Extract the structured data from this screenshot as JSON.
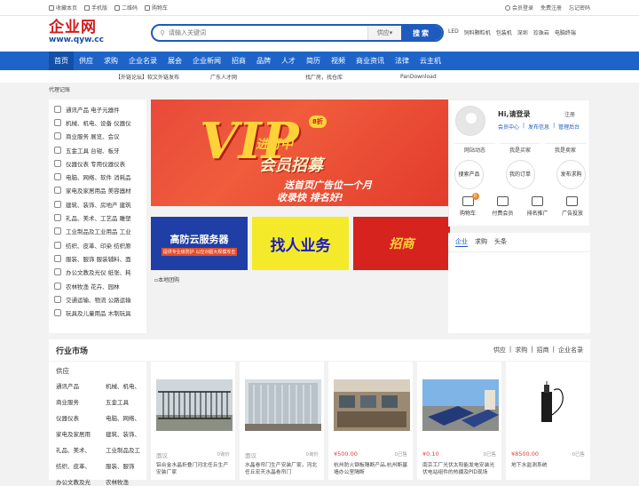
{
  "topbar": {
    "left": [
      "收藏本页",
      "手机版",
      "二维码",
      "购物车"
    ],
    "right": [
      "会员登录",
      "免费注册",
      "忘记密码"
    ]
  },
  "logo": {
    "cn": "企业网",
    "en": "www.qyw.cc"
  },
  "search": {
    "placeholder": "请输入关键词",
    "select": "供应",
    "button": "搜索"
  },
  "hot_keywords": [
    "LED",
    "饲料颗粒机",
    "包装机",
    "深圳",
    "珍珠岩",
    "电脑终端"
  ],
  "nav": [
    "首页",
    "供应",
    "求购",
    "企业名录",
    "展会",
    "企业新闻",
    "招商",
    "品牌",
    "人才",
    "简历",
    "视频",
    "商业资讯",
    "法律",
    "云主机"
  ],
  "subnav": [
    "【外链论坛】软文外链发布",
    "广东人才网",
    "找厂房，找仓库",
    "PanDownload"
  ],
  "agent_text": "代理记账",
  "categories": [
    "通讯产品 电子元器件",
    "机械、机电、设备 仪器仪",
    "商业服务 展览、会议",
    "五金工具 台钳、板牙",
    "仪器仪表 专用仪器仪表",
    "电脑、网络、软件 消耗品",
    "家电及家居用品 美容器材",
    "建筑、装饰、房地产 建筑",
    "礼品、美术、工艺品 雕塑",
    "工业制品及工业用品 工业",
    "纺织、皮革、印染 纺织原",
    "服装、服饰 服装辅料、面",
    "办公文教及光仪 纸张、耗",
    "农林牧渔 花卉、园林",
    "交通运输、物流 公路运输",
    "玩具及儿童用品 木制玩具"
  ],
  "banner": {
    "vip": "VIP",
    "tag": "8折",
    "t1": "进行中",
    "t2": "会员招募",
    "t3": "送首页广告位一个月",
    "t4": "收录快 排名好!"
  },
  "ads": {
    "ad1_title": "高防云服务器",
    "ad1_sub": "提供专业级防护 以应对超大规模攻击",
    "ad2_title": "找人业务",
    "ad3_title": "招商"
  },
  "ad_text": "本地团购",
  "user": {
    "greeting": "Hi,请登录",
    "register": "注册",
    "links": [
      "会员中心",
      "发布信息",
      "管理后台"
    ],
    "tabs": [
      "网站动态",
      "我是买家",
      "我是卖家"
    ],
    "circles": [
      "搜索产品",
      "我的订单",
      "发布求购"
    ],
    "quick": [
      "购物车",
      "付费会员",
      "排名推广",
      "广告投放"
    ],
    "cart_count": "0"
  },
  "news_tabs": [
    "企业",
    "求购",
    "头条"
  ],
  "market": {
    "title": "行业市场",
    "links": [
      "供应",
      "求购",
      "招商",
      "企业名录"
    ]
  },
  "side": {
    "heading": "供应",
    "items": [
      "通讯产品",
      "机械、机电、",
      "商业服务",
      "五金工具",
      "仪器仪表",
      "电脑、网络、",
      "家电及家居用",
      "建筑、装饰、",
      "礼品、美术、",
      "工业制品及工",
      "纺织、皮革、",
      "服装、服饰",
      "办公文教及光",
      "农林牧渔"
    ]
  },
  "products": [
    {
      "price": "面议",
      "count": "0询价",
      "title": "铝合金水晶折叠门河北任丘生产安装厂家",
      "price_red": false
    },
    {
      "price": "面议",
      "count": "0询价",
      "title": "水晶卷帘门生产安装厂家，河北任丘宏天水晶卷帘门",
      "price_red": false
    },
    {
      "price": "¥500.00",
      "count": "0已售",
      "title": "杭州防火钢板隔断产品,杭州断基墙办公室隔断",
      "price_red": true
    },
    {
      "price": "¥0.10",
      "count": "0已售",
      "title": "南京工厂光伏太阳能发电安装光伏电站组件的热摄及PID现场",
      "price_red": true
    },
    {
      "price": "¥8500.00",
      "count": "0已售",
      "title": "地下水监测系统",
      "price_red": true
    }
  ]
}
